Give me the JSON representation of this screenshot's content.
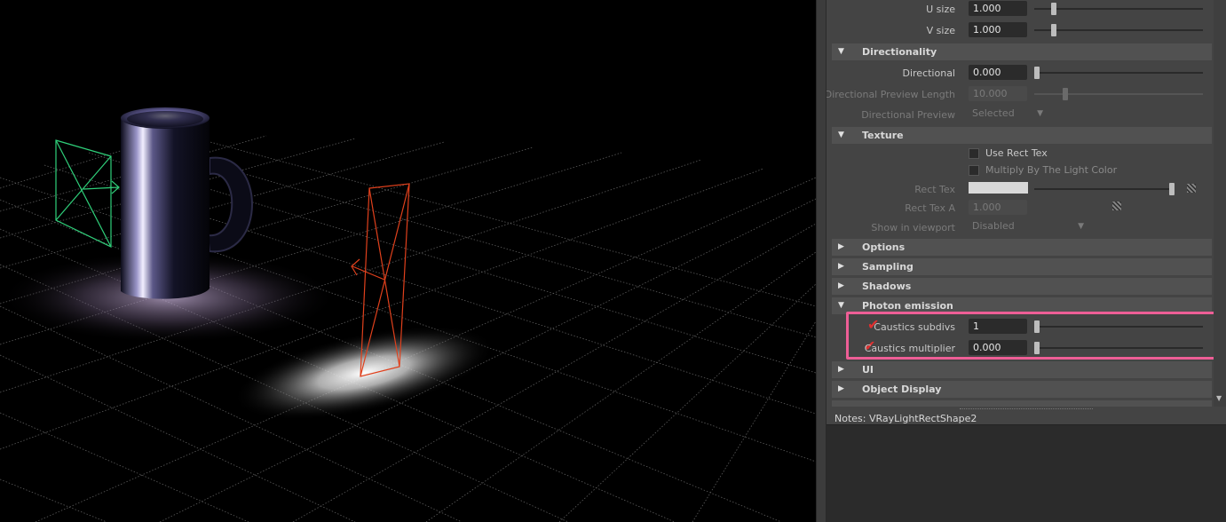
{
  "attributes": {
    "u_size": {
      "label": "U size",
      "value": "1.000",
      "slider": 0.1
    },
    "v_size": {
      "label": "V size",
      "value": "1.000",
      "slider": 0.1
    },
    "sections": {
      "directionality": "Directionality",
      "texture": "Texture",
      "options": "Options",
      "sampling": "Sampling",
      "shadows": "Shadows",
      "photon_emission": "Photon emission",
      "ui": "UI",
      "object_display": "Object Display"
    },
    "directional": {
      "label": "Directional",
      "value": "0.000",
      "slider": 0.0
    },
    "directional_preview_length": {
      "label": "Directional Preview Length",
      "value": "10.000",
      "slider": 0.2
    },
    "directional_preview": {
      "label": "Directional Preview",
      "value": "Selected"
    },
    "use_rect_tex": {
      "label": "Use Rect Tex"
    },
    "multiply_by_light_color": {
      "label": "Multiply By The Light Color"
    },
    "rect_tex": {
      "label": "Rect Tex"
    },
    "rect_tex_a": {
      "label": "Rect Tex A",
      "value": "1.000"
    },
    "show_in_viewport": {
      "label": "Show in viewport",
      "value": "Disabled"
    },
    "caustics_subdivs": {
      "label": "Caustics subdivs",
      "value": "1",
      "slider": 0.0
    },
    "caustics_multiplier": {
      "label": "Caustics multiplier",
      "value": "0.000",
      "slider": 0.0
    }
  },
  "notes": {
    "label": "Notes:",
    "value": "VRayLightRectShape2"
  },
  "colors": {
    "highlight": "#ee5e96",
    "checkmark": "#e03030",
    "panel_bg": "#444444",
    "field_bg": "#2b2b2b"
  },
  "icons": [
    "expand-arrow-icon",
    "collapse-arrow-icon",
    "dropdown-arrow-icon",
    "map-button-icon",
    "red-checkmark-icon",
    "scroll-down-icon"
  ]
}
